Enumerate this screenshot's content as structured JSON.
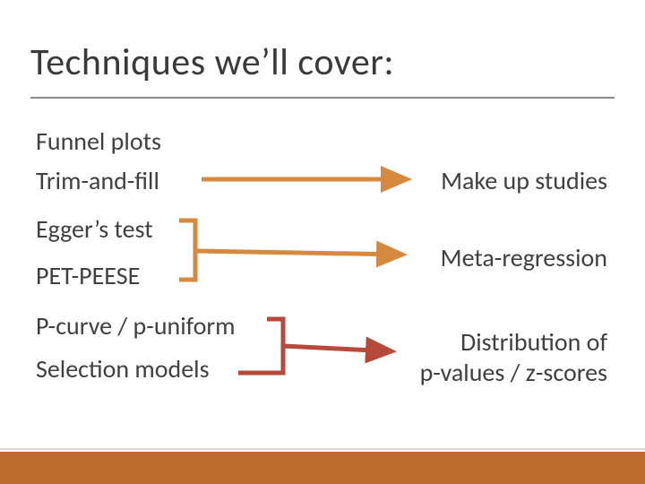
{
  "title": "Techniques we’ll cover:",
  "left_items": {
    "funnel": "Funnel plots",
    "trimfill": "Trim-and-fill",
    "egger": "Egger’s test",
    "petpeese": "PET-PEESE",
    "pcurve": "P-curve / p-uniform",
    "selection": "Selection models"
  },
  "right_items": {
    "makeup": "Make up studies",
    "metareg": "Meta-regression",
    "dist1": "Distribution of",
    "dist2": "p-values / z-scores"
  },
  "colors": {
    "orange": "#d68a3f",
    "red": "#b54a3a",
    "footer": "#be6b2e"
  }
}
